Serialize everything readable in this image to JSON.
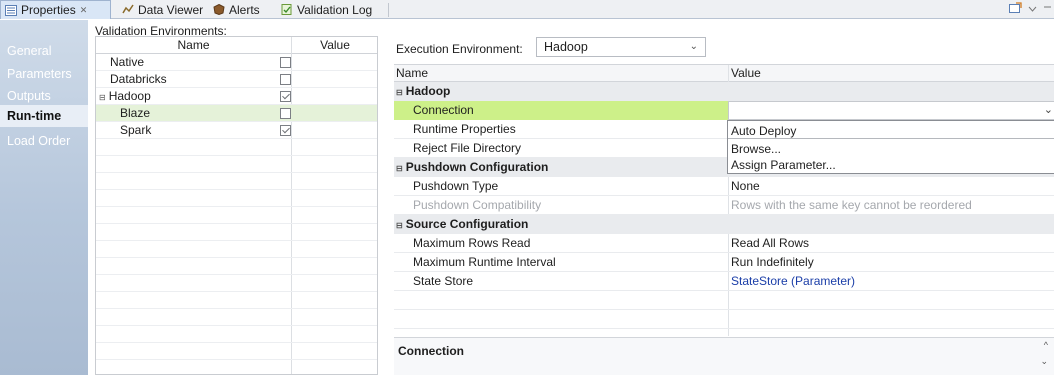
{
  "tabs": [
    {
      "label": "Properties",
      "close": "✕"
    },
    {
      "label": "Data Viewer"
    },
    {
      "label": "Alerts"
    },
    {
      "label": "Validation Log"
    }
  ],
  "left_nav": [
    "General",
    "Parameters",
    "Outputs",
    "Run-time",
    "Load Order"
  ],
  "validation": {
    "title": "Validation Environments:",
    "columns": [
      "Name",
      "Value"
    ],
    "rows": [
      {
        "name": "Native",
        "checked": false
      },
      {
        "name": "Databricks",
        "checked": false
      },
      {
        "name": "Hadoop",
        "checked": true,
        "toggle": "⊟"
      },
      {
        "name": "Blaze",
        "checked": false,
        "selected": true
      },
      {
        "name": "Spark",
        "checked": true
      }
    ]
  },
  "execution": {
    "label": "Execution Environment:",
    "selected": "Hadoop",
    "chevron": "⌄"
  },
  "properties": {
    "columns": [
      "Name",
      "Value"
    ],
    "groups": [
      {
        "title": "Hadoop",
        "toggle": "⊟"
      },
      {
        "title": "Pushdown Configuration",
        "toggle": "⊟"
      },
      {
        "title": "Source Configuration",
        "toggle": "⊟"
      }
    ],
    "rows": {
      "connection": "Connection",
      "runtime_props": "Runtime Properties",
      "reject_dir": "Reject File Directory",
      "pushdown_type": "Pushdown Type",
      "pushdown_type_val": "None",
      "pushdown_compat": "Pushdown Compatibility",
      "pushdown_compat_val": "Rows with the same key cannot be reordered",
      "max_rows": "Maximum Rows Read",
      "max_rows_val": "Read All Rows",
      "max_runtime": "Maximum Runtime Interval",
      "max_runtime_val": "Run Indefinitely",
      "state_store": "State Store",
      "state_store_val": "StateStore (Parameter)"
    }
  },
  "dropdown": [
    "Auto Deploy",
    "Browse...",
    "Assign Parameter..."
  ],
  "description": {
    "title": "Connection"
  },
  "colors": {
    "selected_row": "#e5f2d9",
    "connection_highlight": "#cdf089",
    "link": "#1b3ea8",
    "nav_bg": "#b5c6db"
  }
}
